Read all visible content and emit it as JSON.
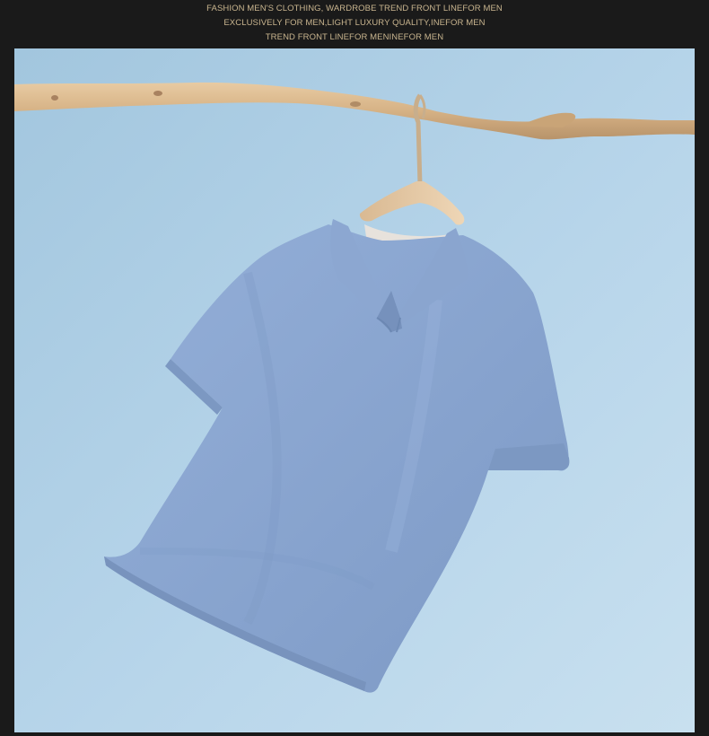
{
  "header": {
    "lines": [
      "FASHION MEN'S CLOTHING, WARDROBE TREND FRONT LINEFOR MEN",
      "EXCLUSIVELY FOR MEN,LIGHT LUXURY QUALITY,INEFOR MEN",
      "TREND FRONT LINEFOR MENINEFOR MEN"
    ],
    "text_color": "#c9b58f"
  },
  "photo": {
    "background_colors": [
      "#9fc4dd",
      "#c3dcec"
    ],
    "shirt_color": "#8aa5cf",
    "branch_color": "#d8b489"
  }
}
